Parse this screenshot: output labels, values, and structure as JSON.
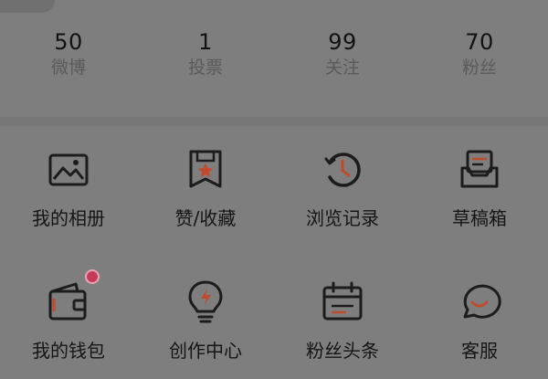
{
  "stats": [
    {
      "value": "50",
      "label": "微博"
    },
    {
      "value": "1",
      "label": "投票"
    },
    {
      "value": "99",
      "label": "关注"
    },
    {
      "value": "70",
      "label": "粉丝"
    }
  ],
  "menu": {
    "row1": [
      {
        "label": "我的相册",
        "icon": "photo-album-icon"
      },
      {
        "label": "赞/收藏",
        "icon": "favorite-icon"
      },
      {
        "label": "浏览记录",
        "icon": "history-clock-icon"
      },
      {
        "label": "草稿箱",
        "icon": "drafts-tray-icon"
      }
    ],
    "row2": [
      {
        "label": "我的钱包",
        "icon": "wallet-icon"
      },
      {
        "label": "创作中心",
        "icon": "creator-bulb-icon"
      },
      {
        "label": "粉丝头条",
        "icon": "calendar-icon"
      },
      {
        "label": "客服",
        "icon": "customer-service-icon"
      }
    ]
  },
  "colors": {
    "background": "#7e7e7e",
    "icon_stroke": "#1c1c1c",
    "accent": "#c24a2c",
    "notification": "#c73a5a"
  }
}
